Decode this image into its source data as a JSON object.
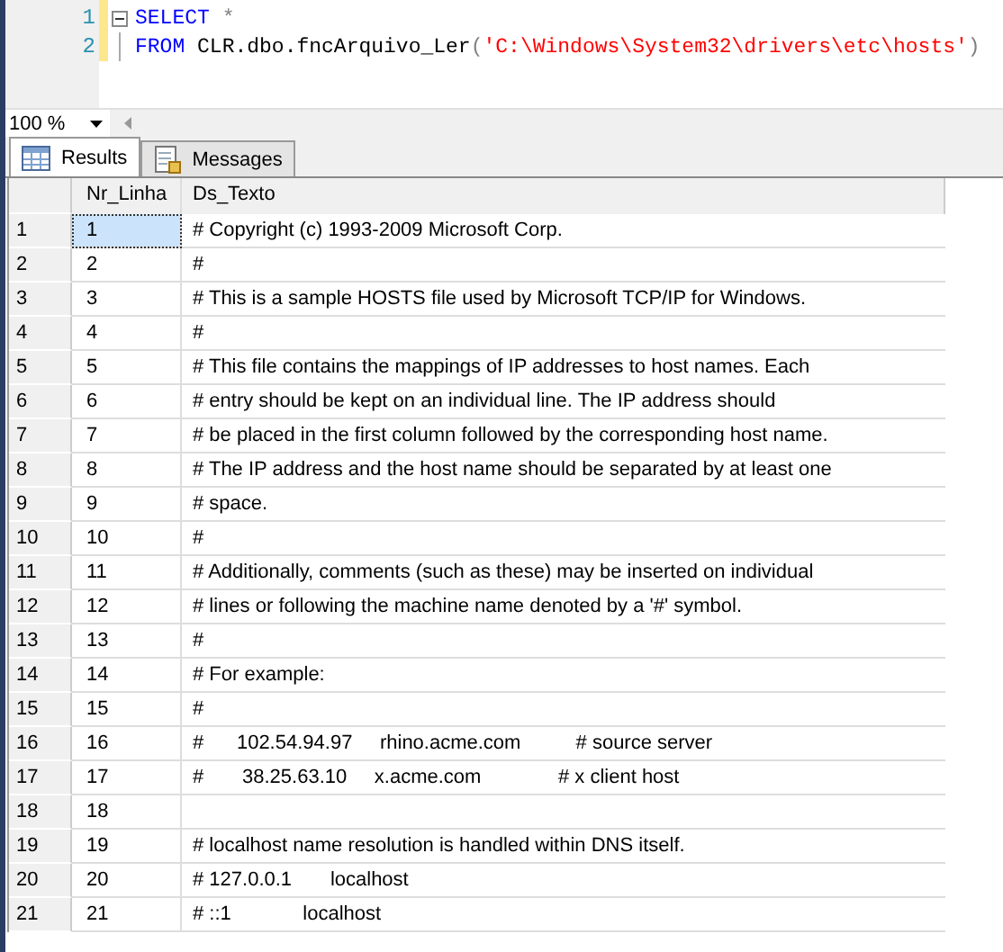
{
  "editor": {
    "lines": [
      {
        "number": "1",
        "tokens": [
          {
            "kind": "keyword",
            "text": "SELECT"
          },
          {
            "kind": "operator",
            "text": " *"
          }
        ]
      },
      {
        "number": "2",
        "tokens": [
          {
            "kind": "keyword",
            "text": "FROM"
          },
          {
            "kind": "plain",
            "text": " CLR.dbo.fncArquivo_Ler"
          },
          {
            "kind": "operator",
            "text": "("
          },
          {
            "kind": "string",
            "text": "'C:\\Windows\\System32\\drivers\\etc\\hosts'"
          },
          {
            "kind": "operator",
            "text": ")"
          }
        ]
      }
    ]
  },
  "zoom": {
    "value": "100 %"
  },
  "tabs": [
    {
      "label": "Results",
      "selected": true
    },
    {
      "label": "Messages",
      "selected": false
    }
  ],
  "table": {
    "columns": [
      "Nr_Linha",
      "Ds_Texto"
    ],
    "rows": [
      {
        "row": "1",
        "nr": "1",
        "text": "# Copyright (c) 1993-2009 Microsoft Corp.",
        "selected": true
      },
      {
        "row": "2",
        "nr": "2",
        "text": "#",
        "selected": false
      },
      {
        "row": "3",
        "nr": "3",
        "text": "# This is a sample HOSTS file used by Microsoft TCP/IP for Windows.",
        "selected": false
      },
      {
        "row": "4",
        "nr": "4",
        "text": "#",
        "selected": false
      },
      {
        "row": "5",
        "nr": "5",
        "text": "# This file contains the mappings of IP addresses to host names. Each",
        "selected": false
      },
      {
        "row": "6",
        "nr": "6",
        "text": "# entry should be kept on an individual line. The IP address should",
        "selected": false
      },
      {
        "row": "7",
        "nr": "7",
        "text": "# be placed in the first column followed by the corresponding host name.",
        "selected": false
      },
      {
        "row": "8",
        "nr": "8",
        "text": "# The IP address and the host name should be separated by at least one",
        "selected": false
      },
      {
        "row": "9",
        "nr": "9",
        "text": "# space.",
        "selected": false
      },
      {
        "row": "10",
        "nr": "10",
        "text": "#",
        "selected": false
      },
      {
        "row": "11",
        "nr": "11",
        "text": "# Additionally, comments (such as these) may be inserted on individual",
        "selected": false
      },
      {
        "row": "12",
        "nr": "12",
        "text": "# lines or following the machine name denoted by a '#' symbol.",
        "selected": false
      },
      {
        "row": "13",
        "nr": "13",
        "text": "#",
        "selected": false
      },
      {
        "row": "14",
        "nr": "14",
        "text": "# For example:",
        "selected": false
      },
      {
        "row": "15",
        "nr": "15",
        "text": "#",
        "selected": false
      },
      {
        "row": "16",
        "nr": "16",
        "text": "#      102.54.94.97     rhino.acme.com          # source server",
        "selected": false
      },
      {
        "row": "17",
        "nr": "17",
        "text": "#       38.25.63.10     x.acme.com              # x client host",
        "selected": false
      },
      {
        "row": "18",
        "nr": "18",
        "text": "",
        "selected": false
      },
      {
        "row": "19",
        "nr": "19",
        "text": "# localhost name resolution is handled within DNS itself.",
        "selected": false
      },
      {
        "row": "20",
        "nr": "20",
        "text": "# 127.0.0.1       localhost",
        "selected": false
      },
      {
        "row": "21",
        "nr": "21",
        "text": "# ::1             localhost",
        "selected": false
      }
    ]
  }
}
